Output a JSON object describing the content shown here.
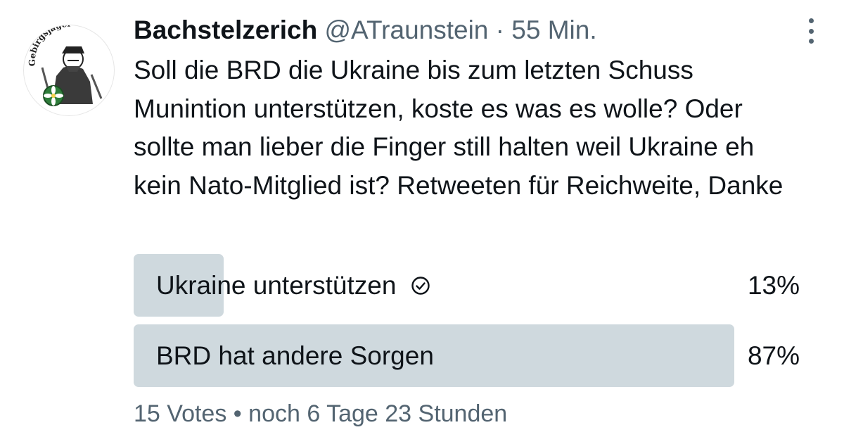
{
  "tweet": {
    "display_name": "Bachstelzerich",
    "handle": "@ATraunstein",
    "separator": "·",
    "time": "55 Min.",
    "avatar": {
      "text": "Gebirgsjäger",
      "icon": "gebirgsjaeger-emblem-icon"
    },
    "text": "Soll die BRD die Ukraine bis zum letzten Schuss Munintion unterstützen, koste es was es wolle? Oder sollte man lieber die Finger still halten weil Ukraine eh kein Nato-Mitglied ist? Retweeten für Reichweite, Danke"
  },
  "poll": {
    "options": [
      {
        "label": "Ukraine unterstützen",
        "percent_text": "13%",
        "percent": 13,
        "voted": true
      },
      {
        "label": "BRD hat andere Sorgen",
        "percent_text": "87%",
        "percent": 87,
        "voted": false
      }
    ],
    "votes": "15 Votes",
    "bullet": "•",
    "remaining": "noch 6 Tage 23 Stunden"
  },
  "colors": {
    "bar": "#cfd9de",
    "text": "#0f1419",
    "secondary": "#536471"
  }
}
